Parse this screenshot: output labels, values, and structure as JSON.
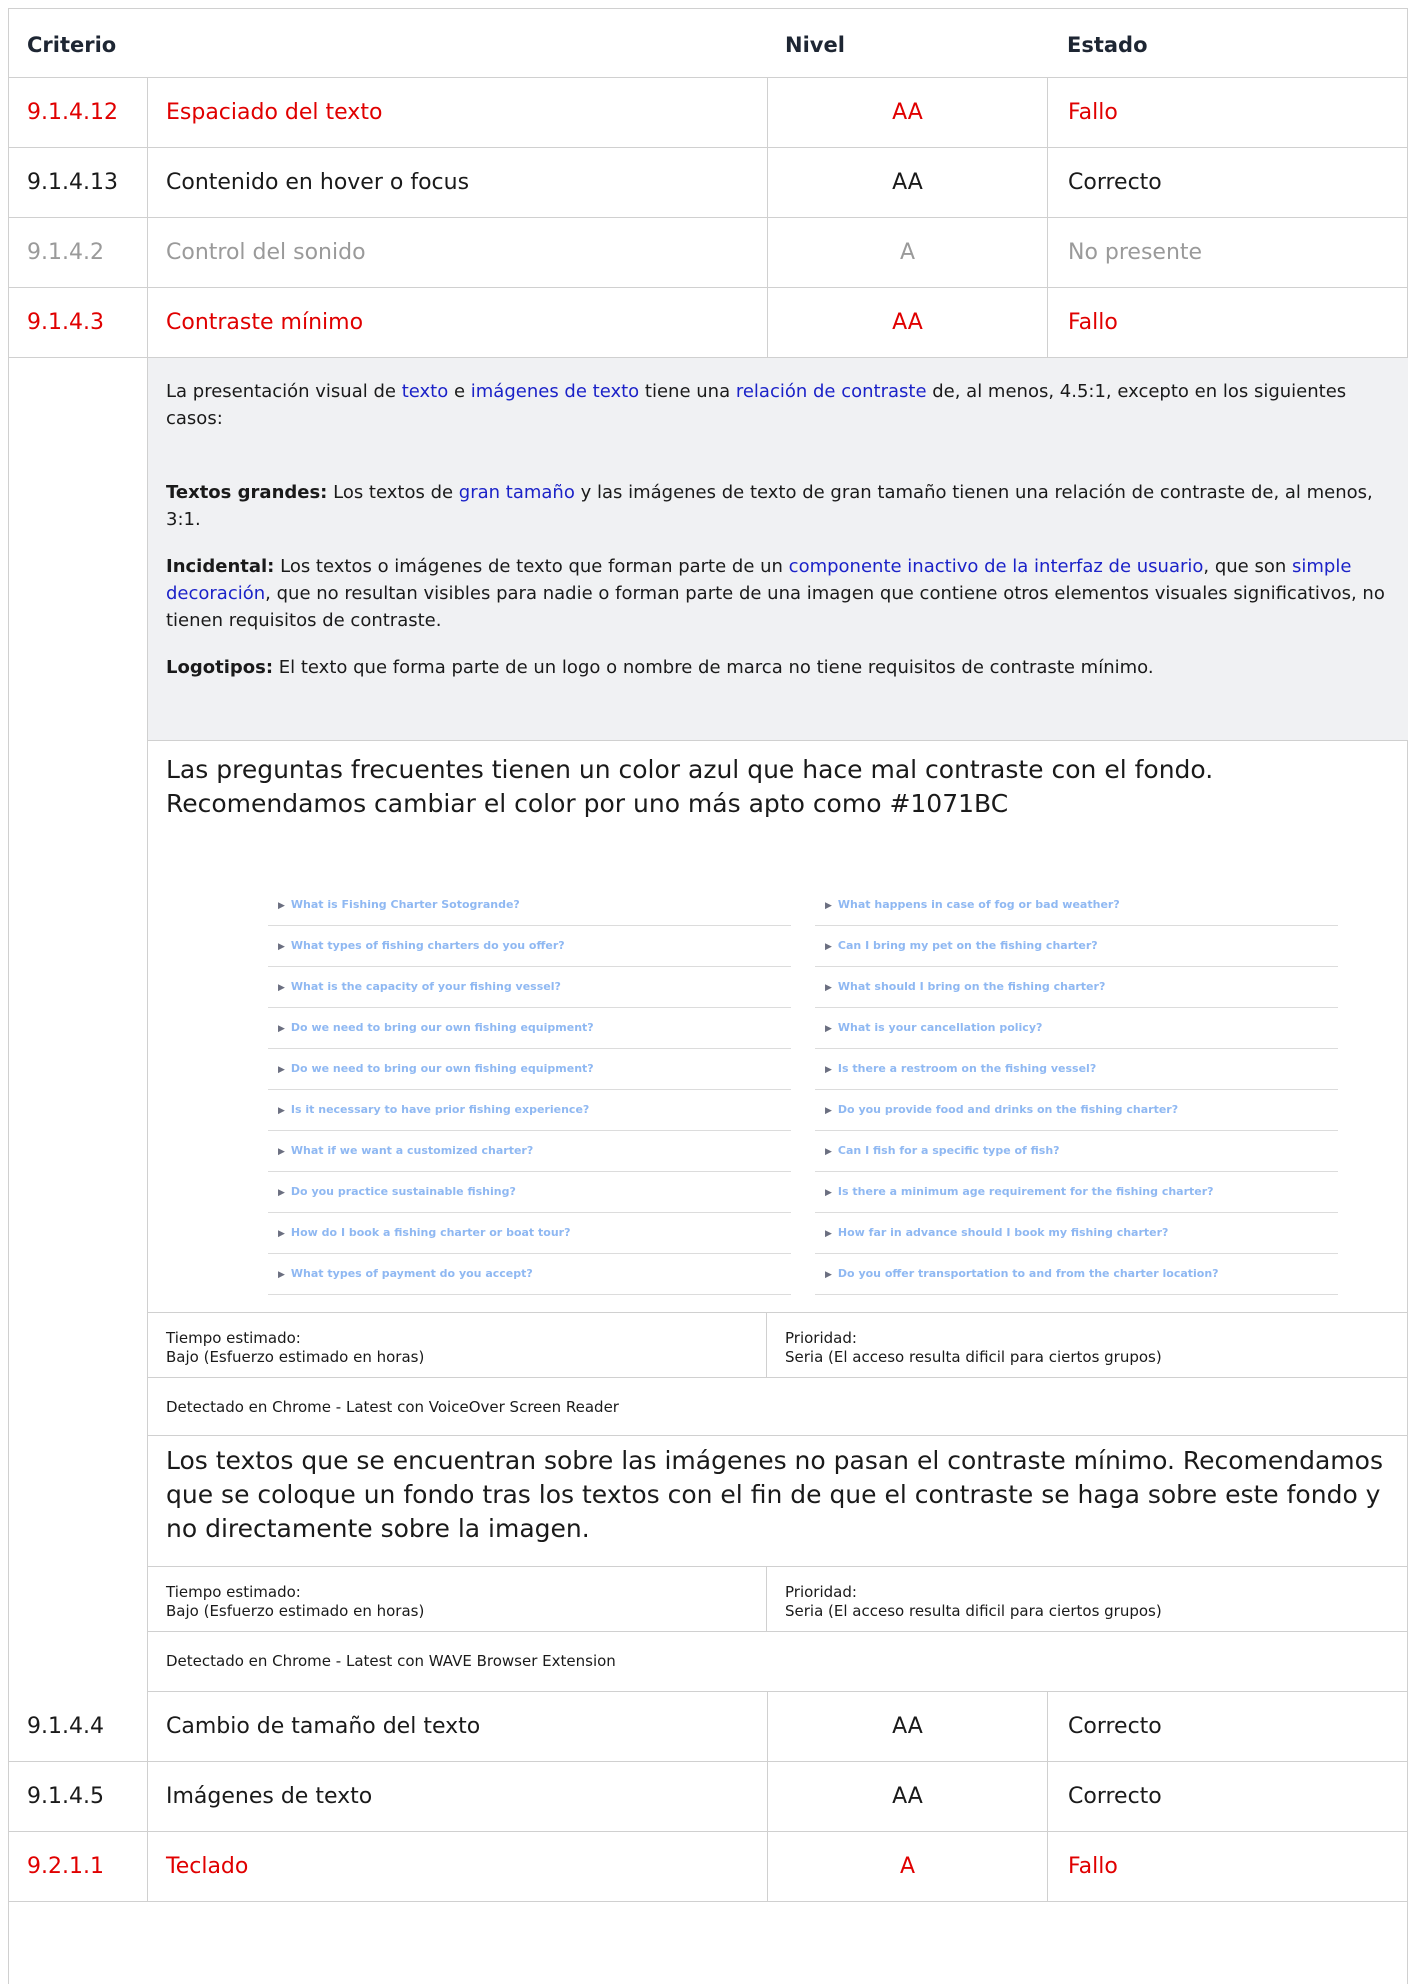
{
  "header": {
    "criterio": "Criterio",
    "nivel": "Nivel",
    "estado": "Estado"
  },
  "rows_top": [
    {
      "id": "9.1.4.12",
      "name": "Espaciado del texto",
      "level": "AA",
      "status": "Fallo",
      "kind": "fail"
    },
    {
      "id": "9.1.4.13",
      "name": "Contenido en hover o focus",
      "level": "AA",
      "status": "Correcto",
      "kind": "ok"
    },
    {
      "id": "9.1.4.2",
      "name": "Control del sonido",
      "level": "A",
      "status": "No presente",
      "kind": "np"
    },
    {
      "id": "9.1.4.3",
      "name": "Contraste mínimo",
      "level": "AA",
      "status": "Fallo",
      "kind": "fail"
    }
  ],
  "description": {
    "p1_a": "La presentación visual de ",
    "p1_link1": "texto",
    "p1_b": " e ",
    "p1_link2": "imágenes de texto",
    "p1_c": " tiene una ",
    "p1_link3": "relación de contraste",
    "p1_d": " de, al menos, 4.5:1, excepto en los siguientes casos:",
    "p2_label": "Textos grandes:",
    "p2_a": " Los textos de ",
    "p2_link": "gran tamaño",
    "p2_b": " y las imágenes de texto de gran tamaño tienen una relación de contraste de, al menos, 3:1.",
    "p3_label": "Incidental:",
    "p3_a": " Los textos o imágenes de texto que forman parte de un ",
    "p3_link1": "componente inactivo de la interfaz de usuario",
    "p3_b": ", que son ",
    "p3_link2": "simple decoración",
    "p3_c": ", que no resultan visibles para nadie o forman parte de una imagen que contiene otros elementos visuales significativos, no tienen requisitos de contraste.",
    "p4_label": "Logotipos:",
    "p4_a": " El texto que forma parte de un logo o nombre de marca no tiene requisitos de contraste mínimo."
  },
  "finding1": {
    "text": "Las preguntas frecuentes tienen un color azul que hace mal contraste con el fondo. Recomendamos cambiar el color por uno más apto como #1071BC",
    "faq_left": [
      "What is Fishing Charter Sotogrande?",
      "What types of fishing charters do you offer?",
      "What is the capacity of your fishing vessel?",
      "Do we need to bring our own fishing equipment?",
      "Do we need to bring our own fishing equipment?",
      "Is it necessary to have prior fishing experience?",
      "What if we want a customized charter?",
      "Do you practice sustainable fishing?",
      "How do I book a fishing charter or boat tour?",
      "What types of payment do you accept?"
    ],
    "faq_right": [
      "What happens in case of fog or bad weather?",
      "Can I bring my pet on the fishing charter?",
      "What should I bring on the fishing charter?",
      "What is your cancellation policy?",
      "Is there a restroom on the fishing vessel?",
      "Do you provide food and drinks on the fishing charter?",
      "Can I fish for a specific type of fish?",
      "Is there a minimum age requirement for the fishing charter?",
      "How far in advance should I book my fishing charter?",
      "Do you offer transportation to and from the charter location?"
    ],
    "time_label": "Tiempo estimado:",
    "time_value": "Bajo (Esfuerzo estimado en horas)",
    "priority_label": "Prioridad:",
    "priority_value": "Seria (El acceso resulta dificil para ciertos grupos)",
    "detected": "Detectado en Chrome - Latest con VoiceOver Screen Reader"
  },
  "finding2": {
    "text": "Los textos que se encuentran sobre las imágenes no pasan el contraste mínimo. Recomendamos que se coloque un fondo tras los textos con el fin de que el contraste se haga sobre este fondo y no directamente sobre la imagen.",
    "time_label": "Tiempo estimado:",
    "time_value": "Bajo (Esfuerzo estimado en horas)",
    "priority_label": "Prioridad:",
    "priority_value": "Seria (El acceso resulta dificil para ciertos grupos)",
    "detected": "Detectado en Chrome - Latest con WAVE Browser Extension"
  },
  "rows_bottom": [
    {
      "id": "9.1.4.4",
      "name": "Cambio de tamaño del texto",
      "level": "AA",
      "status": "Correcto",
      "kind": "ok"
    },
    {
      "id": "9.1.4.5",
      "name": "Imágenes de texto",
      "level": "AA",
      "status": "Correcto",
      "kind": "ok"
    },
    {
      "id": "9.2.1.1",
      "name": "Teclado",
      "level": "A",
      "status": "Fallo",
      "kind": "fail"
    }
  ],
  "colors": {
    "fail": "#e00000",
    "link": "#1b22c8",
    "faq_text": "#8fb8f2",
    "muted": "#9a9a9a"
  }
}
